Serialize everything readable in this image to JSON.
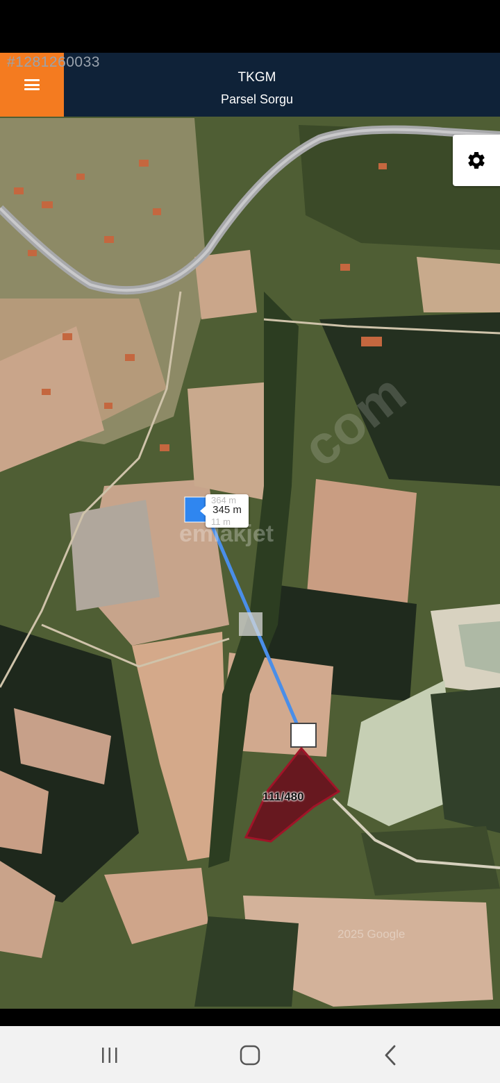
{
  "header": {
    "listing_id": "#1281260033",
    "title": "TKGM",
    "subtitle": "Parsel Sorgu"
  },
  "icons": {
    "menu": "hamburger-menu-icon",
    "settings": "gear-icon",
    "nav_recents": "recent-apps-icon",
    "nav_home": "home-icon",
    "nav_back": "back-icon"
  },
  "map": {
    "distance_label": "345 m",
    "ghost_label_top": "364 m",
    "ghost_label_bottom": "11 m",
    "parcel_label": "111/480",
    "credit": "2025 Google",
    "watermark_brand": "emlakjet",
    "watermark_domain": "com"
  },
  "colors": {
    "appbar_bg": "#0f2238",
    "menu_accent": "#f47b20",
    "measure_line": "#4a8ee8",
    "parcel_fill": "#6b0f1c",
    "parcel_stroke": "#a01428"
  }
}
